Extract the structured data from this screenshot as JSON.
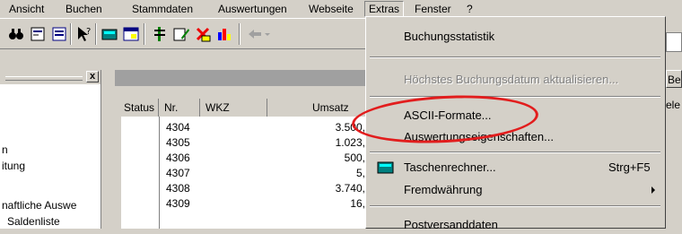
{
  "menubar": {
    "items": [
      {
        "label": "Ansicht",
        "u": "A"
      },
      {
        "label": "Buchen",
        "u": "u"
      },
      {
        "label": "Stammdaten",
        "u": "S"
      },
      {
        "label": "Auswertungen",
        "u": "w"
      },
      {
        "label": "Webseite",
        "u": "i"
      },
      {
        "label": "Extras",
        "u": "x"
      },
      {
        "label": "Fenster",
        "u": "F"
      },
      {
        "label": "?",
        "u": "?"
      }
    ]
  },
  "left_pane": {
    "close_glyph": "x",
    "tree_items": [
      "n",
      "itung",
      "naftliche Auswe",
      "Saldenliste"
    ]
  },
  "grid": {
    "columns": [
      "Status",
      "Nr.",
      "WKZ",
      "Umsatz"
    ],
    "rows": [
      {
        "status": "",
        "nr": "4304",
        "wkz": "",
        "umsatz": "3.500,"
      },
      {
        "status": "",
        "nr": "4305",
        "wkz": "",
        "umsatz": "1.023,"
      },
      {
        "status": "",
        "nr": "4306",
        "wkz": "",
        "umsatz": "500,"
      },
      {
        "status": "",
        "nr": "4307",
        "wkz": "",
        "umsatz": "5,"
      },
      {
        "status": "",
        "nr": "4308",
        "wkz": "",
        "umsatz": "3.740,"
      },
      {
        "status": "",
        "nr": "4309",
        "wkz": "",
        "umsatz": "16,"
      }
    ]
  },
  "right_edge": {
    "label_top": "Be",
    "label_bottom": "ele"
  },
  "extras_menu": {
    "items": [
      {
        "label": "Buchungsstatistik",
        "enabled": true
      },
      {
        "label": "Höchstes Buchungsdatum aktualisieren...",
        "enabled": false
      },
      {
        "label": "ASCII-Formate...",
        "enabled": true,
        "highlighted": true
      },
      {
        "label": "Auswertungseigenschaften...",
        "enabled": true
      },
      {
        "label": "Taschenrechner...",
        "shortcut": "Strg+F5",
        "enabled": true,
        "icon": "calculator-icon"
      },
      {
        "label": "Fremdwährung",
        "enabled": true,
        "submenu": true
      },
      {
        "label": "Postversanddaten",
        "enabled": true
      }
    ]
  },
  "colors": {
    "menu_bg": "#d4d0c8",
    "highlight": "#0a246a",
    "annotation": "#e21d1d"
  }
}
